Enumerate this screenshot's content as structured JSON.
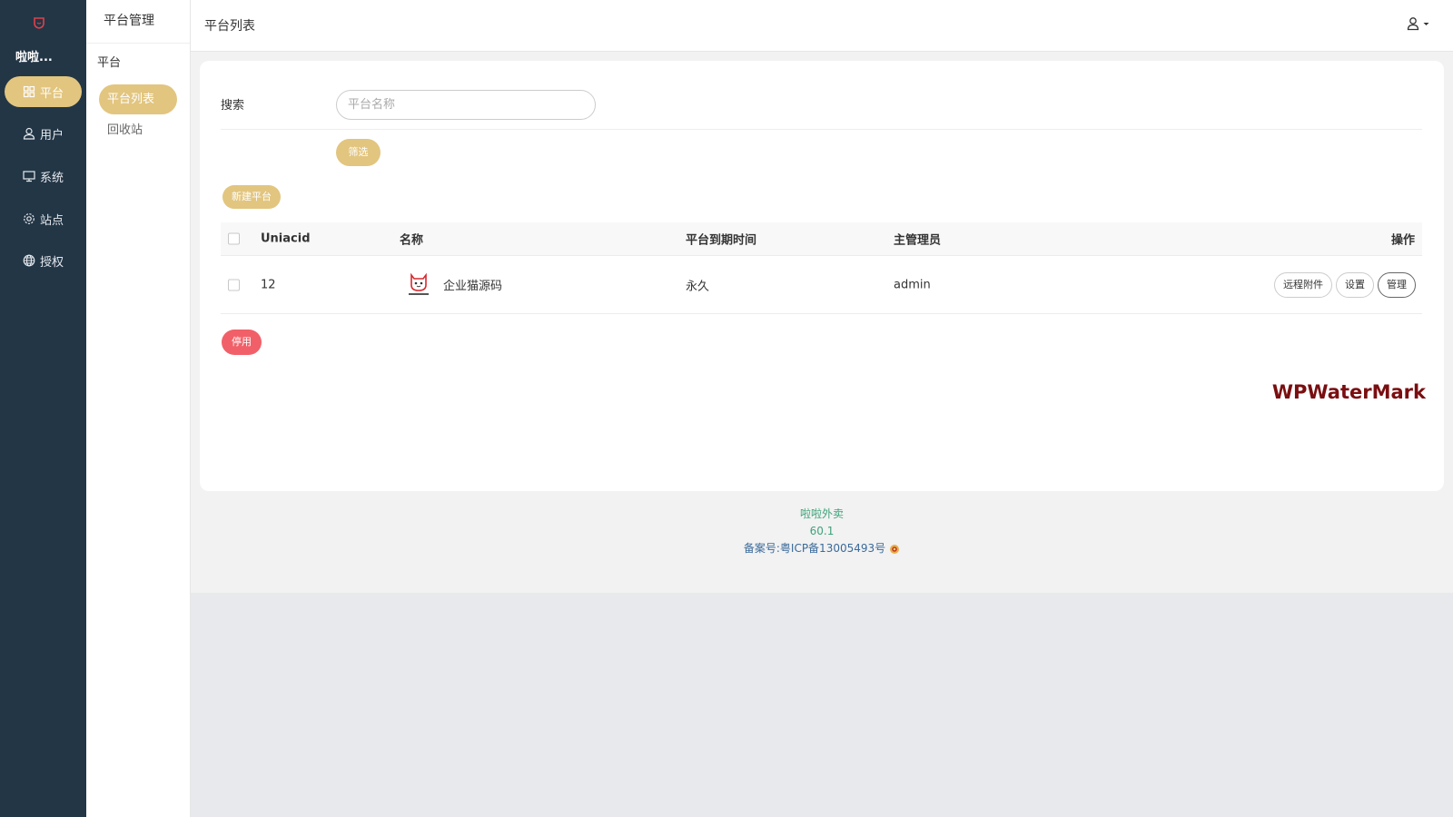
{
  "sidebar": {
    "site_name": "啦啦...",
    "items": [
      {
        "label": "平台",
        "icon": "grid-icon",
        "active": true
      },
      {
        "label": "用户",
        "icon": "user-icon",
        "active": false
      },
      {
        "label": "系统",
        "icon": "monitor-icon",
        "active": false
      },
      {
        "label": "站点",
        "icon": "gear-icon",
        "active": false
      },
      {
        "label": "授权",
        "icon": "globe-icon",
        "active": false
      }
    ]
  },
  "subnav": {
    "title": "平台管理",
    "group": "平台",
    "items": [
      {
        "label": "平台列表",
        "active": true
      },
      {
        "label": "回收站",
        "active": false
      }
    ]
  },
  "header": {
    "title": "平台列表",
    "user_icon": "user-dropdown-icon"
  },
  "search": {
    "label": "搜索",
    "placeholder": "平台名称",
    "value": "",
    "filter_label": "筛选"
  },
  "actions": {
    "new_label": "新建平台",
    "disable_label": "停用"
  },
  "table": {
    "columns": [
      "Uniacid",
      "名称",
      "平台到期时间",
      "主管理员",
      "操作"
    ],
    "rows": [
      {
        "uniacid": "12",
        "name": "企业猫源码",
        "expire": "永久",
        "admin": "admin",
        "ops": [
          "远程附件",
          "设置",
          "管理"
        ]
      }
    ]
  },
  "watermark": "WPWaterMark",
  "footer": {
    "line1": "啦啦外卖",
    "line2": "60.1",
    "line3": "备案号:粤ICP备13005493号"
  },
  "colors": {
    "sidebar_bg": "#233646",
    "accent": "#e2c57f",
    "danger": "#f16068",
    "footer_green": "#3ea37b"
  }
}
